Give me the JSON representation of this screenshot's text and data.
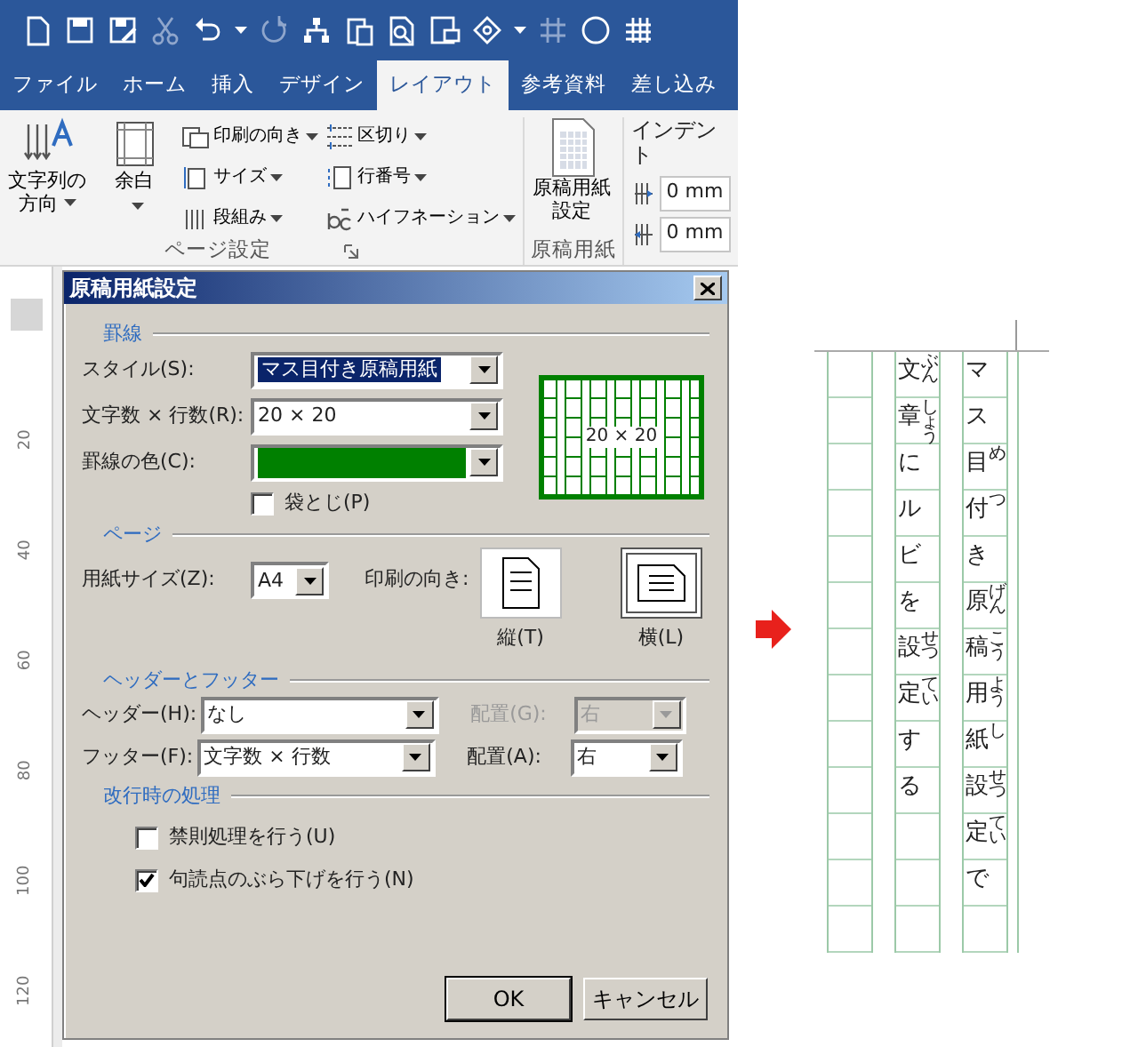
{
  "quick_access": [
    {
      "kind": "new",
      "disabled": false
    },
    {
      "kind": "save",
      "disabled": false
    },
    {
      "kind": "save_edit",
      "disabled": false
    },
    {
      "kind": "cut",
      "disabled": true
    },
    {
      "kind": "undo",
      "disabled": false
    },
    {
      "kind": "caret",
      "disabled": false
    },
    {
      "kind": "redo",
      "disabled": true
    },
    {
      "kind": "tree",
      "disabled": false
    },
    {
      "kind": "clipboard",
      "disabled": false
    },
    {
      "kind": "preview",
      "disabled": false
    },
    {
      "kind": "screen",
      "disabled": false
    },
    {
      "kind": "shape",
      "disabled": false
    },
    {
      "kind": "caret",
      "disabled": false
    },
    {
      "kind": "hash",
      "disabled": true
    },
    {
      "kind": "circle",
      "disabled": false
    },
    {
      "kind": "grid",
      "disabled": false
    }
  ],
  "tabs": [
    {
      "label": "ファイル",
      "selected": false
    },
    {
      "label": "ホーム",
      "selected": false
    },
    {
      "label": "挿入",
      "selected": false
    },
    {
      "label": "デザイン",
      "selected": false
    },
    {
      "label": "レイアウト",
      "selected": true
    },
    {
      "label": "参考資料",
      "selected": false
    },
    {
      "label": "差し込み",
      "selected": false
    }
  ],
  "ribbon": {
    "page_setup": {
      "label": "ページ設定",
      "large": [
        {
          "kind": "text_direction",
          "label": "文字列の方向"
        },
        {
          "kind": "margins",
          "label": "余白"
        }
      ],
      "small": [
        {
          "kind": "orientation",
          "label": "印刷の向き"
        },
        {
          "kind": "size",
          "label": "サイズ"
        },
        {
          "kind": "columns",
          "label": "段組み"
        },
        {
          "kind": "breaks",
          "label": "区切り"
        },
        {
          "kind": "line_numbers",
          "label": "行番号"
        },
        {
          "kind": "hyphenation",
          "label": "ハイフネーション"
        }
      ]
    },
    "manuscript": {
      "label": "原稿用紙",
      "button": "原稿用紙設定"
    },
    "indent": {
      "label": "インデント",
      "fields": [
        {
          "kind": "left",
          "value": "0 mm"
        },
        {
          "kind": "right",
          "value": "0 mm"
        }
      ]
    }
  },
  "ruler": {
    "labels": [
      "20",
      "40",
      "60",
      "80",
      "100",
      "120"
    ]
  },
  "dialog": {
    "title": "原稿用紙設定",
    "ruled_lines": {
      "heading": "罫線",
      "style": {
        "label": "スタイル(S):",
        "value": "マス目付き原稿用紙",
        "focused": true
      },
      "grid_size": {
        "label": "文字数 × 行数(R):",
        "value": "20 × 20"
      },
      "line_color": {
        "label": "罫線の色(C):",
        "color": "#008000"
      },
      "bound": {
        "label": "袋とじ(P)",
        "checked": false
      },
      "preview": {
        "label": "20 × 20"
      }
    },
    "page": {
      "heading": "ページ",
      "paper_size": {
        "label": "用紙サイズ(Z):",
        "value": "A4"
      },
      "orientation_label": "印刷の向き:",
      "orientations": [
        {
          "kind": "portrait",
          "label": "縦(T)",
          "selected": false
        },
        {
          "kind": "landscape",
          "label": "横(L)",
          "selected": true
        }
      ]
    },
    "header_footer": {
      "heading": "ヘッダーとフッター",
      "rows": [
        {
          "label": "ヘッダー(H):",
          "value": "なし",
          "align_label": "配置(G):",
          "align_value": "右",
          "align_disabled": true
        },
        {
          "label": "フッター(F):",
          "value": "文字数 × 行数",
          "align_label": "配置(A):",
          "align_value": "右",
          "align_disabled": false
        }
      ]
    },
    "line_break": {
      "heading": "改行時の処理",
      "options": [
        {
          "label": "禁則処理を行う(U)",
          "checked": false
        },
        {
          "label": "句読点のぶら下げを行う(N)",
          "checked": true
        }
      ]
    },
    "buttons": [
      {
        "label": "OK",
        "default": true
      },
      {
        "label": "キャンセル",
        "default": false
      }
    ]
  },
  "manuscript": {
    "columns": [
      {
        "cells": [
          {
            "char": "マ"
          },
          {
            "char": "ス"
          },
          {
            "char": "目",
            "ruby": "め"
          },
          {
            "char": "付",
            "ruby": "つ"
          },
          {
            "char": "き"
          },
          {
            "char": "原",
            "ruby": "げん"
          },
          {
            "char": "稿",
            "ruby": "こう"
          },
          {
            "char": "用",
            "ruby": "よう"
          },
          {
            "char": "紙",
            "ruby": "し"
          },
          {
            "char": "設",
            "ruby": "せつ"
          },
          {
            "char": "定",
            "ruby": "てい"
          },
          {
            "char": "で"
          }
        ]
      },
      {
        "cells": [
          {
            "char": "文",
            "ruby": "ぶん"
          },
          {
            "char": "章",
            "ruby": "しょう"
          },
          {
            "char": "に"
          },
          {
            "char": "ル"
          },
          {
            "char": "ビ"
          },
          {
            "char": "を"
          },
          {
            "char": "設",
            "ruby": "せつ"
          },
          {
            "char": "定",
            "ruby": "てい"
          },
          {
            "char": "す"
          },
          {
            "char": "る"
          }
        ]
      }
    ]
  }
}
